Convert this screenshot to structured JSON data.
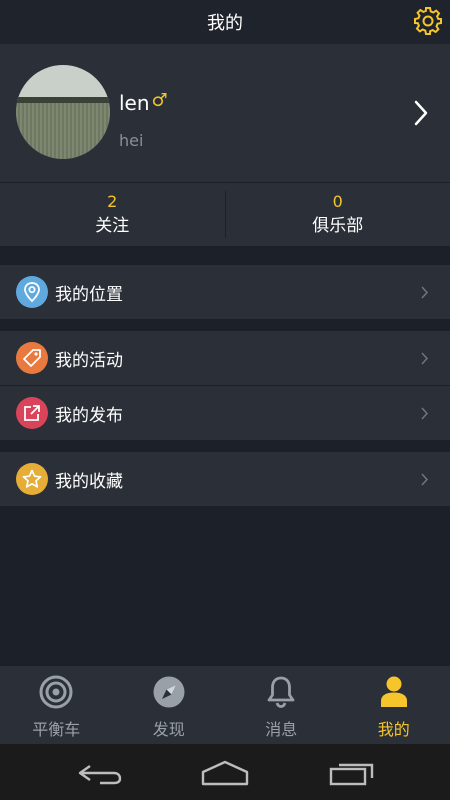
{
  "header": {
    "title": "我的"
  },
  "profile": {
    "username": "len",
    "gender_symbol": "♂",
    "signature": "hei"
  },
  "stats": [
    {
      "value": "2",
      "label": "关注"
    },
    {
      "value": "0",
      "label": "俱乐部"
    }
  ],
  "menu": [
    {
      "label": "我的位置",
      "icon": "location-pin-icon",
      "color": "#5fa9de"
    },
    {
      "label": "我的活动",
      "icon": "tag-icon",
      "color": "#e8793f"
    },
    {
      "label": "我的发布",
      "icon": "share-external-icon",
      "color": "#d9445b"
    },
    {
      "label": "我的收藏",
      "icon": "star-icon",
      "color": "#e6ad37"
    }
  ],
  "tabs": [
    {
      "label": "平衡车",
      "icon": "target-icon"
    },
    {
      "label": "发现",
      "icon": "compass-icon"
    },
    {
      "label": "消息",
      "icon": "bell-icon"
    },
    {
      "label": "我的",
      "icon": "person-icon",
      "active": true
    }
  ],
  "colors": {
    "accent": "#f5c52b",
    "background": "#1c2028",
    "panel": "#2a2f38"
  }
}
